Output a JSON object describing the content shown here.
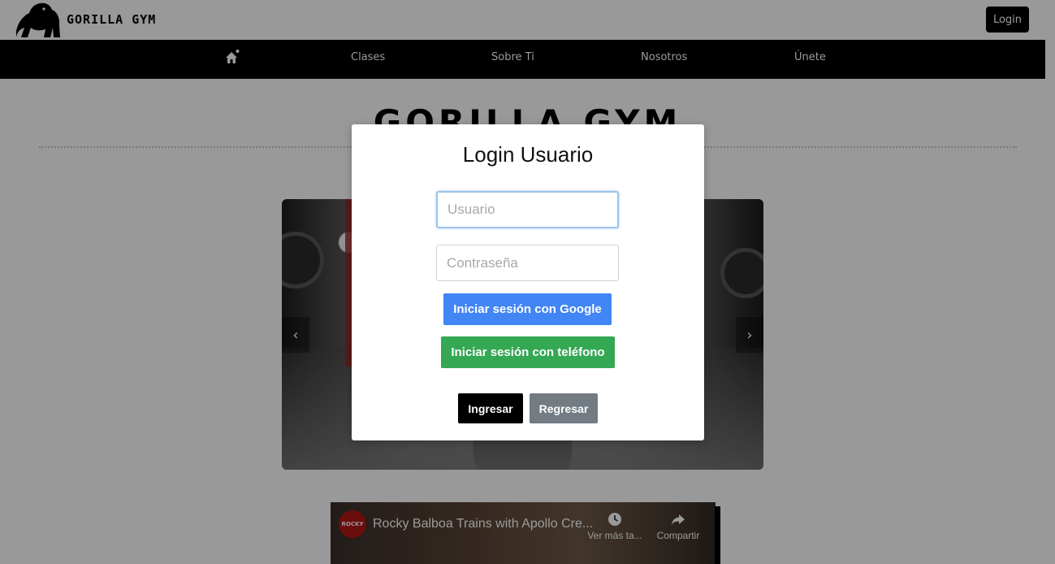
{
  "header": {
    "brand": "GORILLA GYM",
    "login_button": "Login"
  },
  "nav": {
    "home_icon": "home-icon",
    "items": [
      "Clases",
      "Sobre Ti",
      "Nosotros",
      "Únete"
    ]
  },
  "hero": {
    "title": "GORILLA GYM"
  },
  "carousel": {
    "prev": "‹",
    "next": "›"
  },
  "video": {
    "channel_badge": "ROCKY",
    "title": "Rocky Balboa Trains with Apollo Cre...",
    "watch_later": "Ver más ta...",
    "share": "Compartir"
  },
  "modal": {
    "title": "Login Usuario",
    "username_placeholder": "Usuario",
    "password_placeholder": "Contraseña",
    "google_button": "Iniciar sesión con Google",
    "phone_button": "Iniciar sesión con teléfono",
    "submit_button": "Ingresar",
    "back_button": "Regresar"
  },
  "colors": {
    "google_blue": "#4285f4",
    "phone_green": "#34a853",
    "nav_black": "#000000",
    "back_gray": "#6c757d",
    "focus_outline": "#9cc3e8"
  }
}
